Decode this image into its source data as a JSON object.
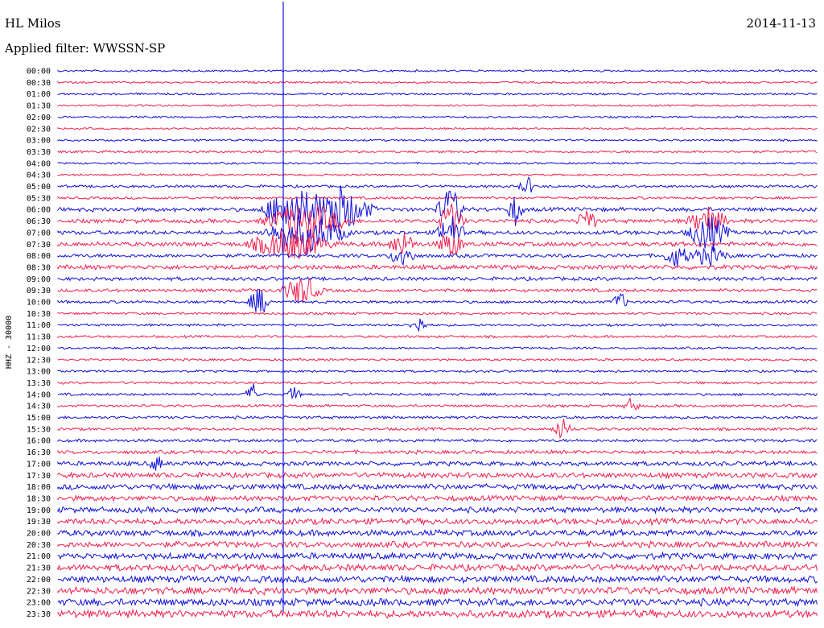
{
  "header": {
    "station": "HL Milos",
    "date": "2014-11-13",
    "filter": "Applied filter: WWSSN-SP"
  },
  "chart_data": {
    "type": "line",
    "title": "HL Milos",
    "ylabel": "HHZ - 30000",
    "row_labels": [
      "00:00",
      "00:30",
      "01:00",
      "01:30",
      "02:00",
      "02:30",
      "03:00",
      "03:30",
      "04:00",
      "04:30",
      "05:00",
      "05:30",
      "06:00",
      "06:30",
      "07:00",
      "07:30",
      "08:00",
      "08:30",
      "09:00",
      "09:30",
      "10:00",
      "10:30",
      "11:00",
      "11:30",
      "12:00",
      "12:30",
      "13:00",
      "13:30",
      "14:00",
      "14:30",
      "15:00",
      "15:30",
      "16:00",
      "16:30",
      "17:00",
      "17:30",
      "18:00",
      "18:30",
      "19:00",
      "19:30",
      "20:00",
      "20:30",
      "21:00",
      "21:30",
      "22:00",
      "22:30",
      "23:00",
      "23:30"
    ],
    "series_colors": [
      "#1010d8",
      "#f0204e"
    ],
    "noise_level": [
      1,
      1,
      1,
      1,
      1,
      1,
      1,
      1.2,
      1,
      1,
      1.3,
      1.3,
      2,
      2,
      2,
      2.2,
      1.8,
      2.2,
      1.8,
      1.6,
      1.4,
      1.2,
      1.2,
      1.2,
      1.1,
      1.1,
      1.1,
      1.2,
      1.3,
      1.3,
      1.4,
      1.4,
      1.5,
      1.8,
      2.2,
      2.6,
      2.8,
      2.6,
      2.8,
      3,
      3,
      3,
      3.2,
      3.2,
      3.4,
      3.6,
      3.6,
      3.8
    ]
  }
}
